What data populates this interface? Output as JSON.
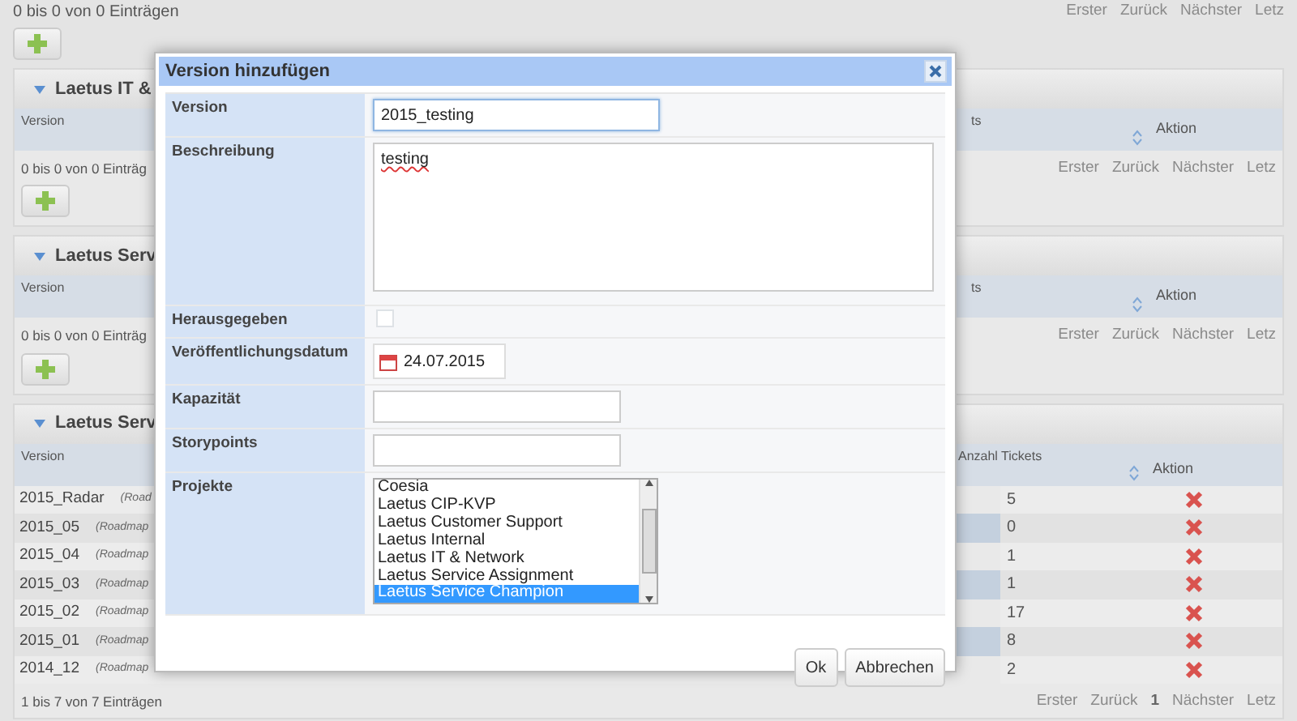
{
  "background": {
    "top_info": "0 bis 0 von 0 Einträgen",
    "top_pager": [
      "Erster",
      "Zurück",
      "Nächster",
      "Letz"
    ],
    "sections": [
      {
        "title": "Laetus IT &",
        "expanded": true,
        "columns": [
          "Version",
          "ts",
          "Aktion"
        ],
        "info": "0 bis 0 von 0 Einträg",
        "pager": [
          "Erster",
          "Zurück",
          "Nächster",
          "Letz"
        ]
      },
      {
        "title": "Laetus Serv",
        "expanded": true,
        "columns": [
          "Version",
          "ts",
          "Aktion"
        ],
        "info": "0 bis 0 von 0 Einträg",
        "pager": [
          "Erster",
          "Zurück",
          "Nächster",
          "Letz"
        ]
      },
      {
        "title": "Laetus Serv",
        "expanded": true,
        "columns": [
          "Version",
          "Anzahl Tickets",
          "Aktion"
        ],
        "rows": [
          {
            "version": "2015_Radar",
            "link": "(Road",
            "tickets": "5"
          },
          {
            "version": "2015_05",
            "link": "(Roadmap",
            "tickets": "0"
          },
          {
            "version": "2015_04",
            "link": "(Roadmap",
            "tickets": "1"
          },
          {
            "version": "2015_03",
            "link": "(Roadmap",
            "tickets": "1"
          },
          {
            "version": "2015_02",
            "link": "(Roadmap",
            "tickets": "17"
          },
          {
            "version": "2015_01",
            "link": "(Roadmap",
            "tickets": "8"
          },
          {
            "version": "2014_12",
            "link": "(Roadmap",
            "tickets": "2"
          }
        ],
        "info": "1 bis 7 von 7 Einträgen",
        "pager": [
          "Erster",
          "Zurück",
          "1",
          "Nächster",
          "Letz"
        ]
      }
    ]
  },
  "dialog": {
    "title": "Version hinzufügen",
    "fields": [
      {
        "kind": "text",
        "label": "Version",
        "value": "2015_testing",
        "focused": true
      },
      {
        "kind": "textarea",
        "label": "Beschreibung",
        "value": "testing"
      },
      {
        "kind": "checkbox",
        "label": "Herausgegeben",
        "checked": false
      },
      {
        "kind": "date",
        "label": "Veröffentlichungsdatum",
        "value": "24.07.2015"
      },
      {
        "kind": "text",
        "label": "Kapazität",
        "focused": false
      },
      {
        "kind": "text",
        "label": "Storypoints",
        "focused": false
      },
      {
        "kind": "listbox",
        "label": "Projekte",
        "options": [
          {
            "label": "Coesia",
            "selected": false
          },
          {
            "label": "Laetus CIP-KVP",
            "selected": false
          },
          {
            "label": "Laetus Customer Support",
            "selected": false
          },
          {
            "label": "Laetus Internal",
            "selected": false
          },
          {
            "label": "Laetus IT & Network",
            "selected": false
          },
          {
            "label": "Laetus Service Assignment",
            "selected": false
          },
          {
            "label": "Laetus Service Champion",
            "selected": true
          }
        ]
      }
    ],
    "buttons": [
      "Ok",
      "Abbrechen"
    ]
  }
}
